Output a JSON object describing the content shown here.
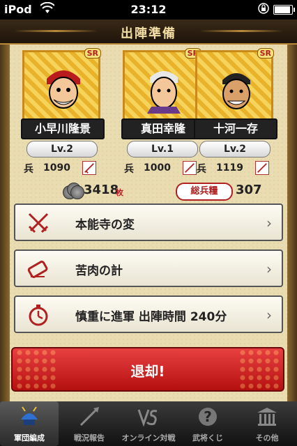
{
  "status_bar": {
    "carrier": "iPod",
    "time": "23:12",
    "battery_level": 0.9
  },
  "header": {
    "title": "出陣準備"
  },
  "generals": [
    {
      "name": "小早川隆景",
      "rarity": "SR",
      "level": "Lv.2",
      "troop_label": "兵",
      "troops": "1090"
    },
    {
      "name": "真田幸隆",
      "rarity": "SR",
      "level": "Lv.1",
      "troop_label": "兵",
      "troops": "1000"
    },
    {
      "name": "十河一存",
      "rarity": "SR",
      "level": "Lv.2",
      "troop_label": "兵",
      "troops": "1119"
    }
  ],
  "resources": {
    "coins": "3418",
    "coin_unit": "枚",
    "total_troops_label": "総兵糧",
    "total_troops": "307"
  },
  "options": [
    {
      "label": "本能寺の変",
      "icon": "crossed-swords-icon"
    },
    {
      "label": "苦肉の計",
      "icon": "scroll-icon"
    },
    {
      "label": "慎重に進軍 出陣時間 240分",
      "icon": "stopwatch-icon"
    }
  ],
  "retreat_button": {
    "label": "退却!"
  },
  "tabs": [
    {
      "label": "軍団編成",
      "icon": "helmet-icon",
      "active": true
    },
    {
      "label": "戦況報告",
      "icon": "spear-icon",
      "active": false
    },
    {
      "label": "オンライン対戦",
      "icon": "versus-icon",
      "active": false
    },
    {
      "label": "武将くじ",
      "icon": "question-icon",
      "active": false
    },
    {
      "label": "その他",
      "icon": "shrine-icon",
      "active": false
    }
  ],
  "colors": {
    "accent": "#c0161b",
    "parchment": "#e9dcb0",
    "gold": "#c98a1a"
  }
}
